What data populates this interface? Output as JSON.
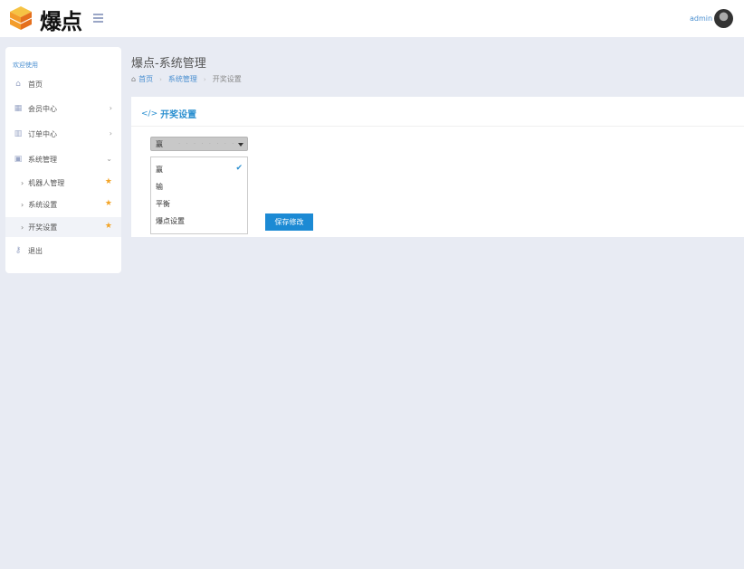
{
  "header": {
    "logo_text": "爆点",
    "user_name": "admin"
  },
  "sidebar": {
    "welcome": "欢迎使用",
    "items": [
      {
        "label": "首页"
      },
      {
        "label": "会员中心"
      },
      {
        "label": "订单中心"
      },
      {
        "label": "系统管理"
      }
    ],
    "sub_items": [
      {
        "label": "机器人管理"
      },
      {
        "label": "系统设置"
      },
      {
        "label": "开奖设置"
      }
    ],
    "logout": "退出"
  },
  "page": {
    "title": "爆点-系统管理",
    "breadcrumb": {
      "home": "首页",
      "section": "系统管理",
      "current": "开奖设置"
    }
  },
  "card": {
    "title": "开奖设置",
    "select": {
      "selected": "赢",
      "options": [
        "赢",
        "输",
        "平衡",
        "爆点设置"
      ]
    },
    "save_label": "保存修改"
  },
  "colors": {
    "accent": "#2a8fd0",
    "button": "#1c8ad4",
    "star": "#f3a427",
    "background": "#e8ebf3"
  }
}
